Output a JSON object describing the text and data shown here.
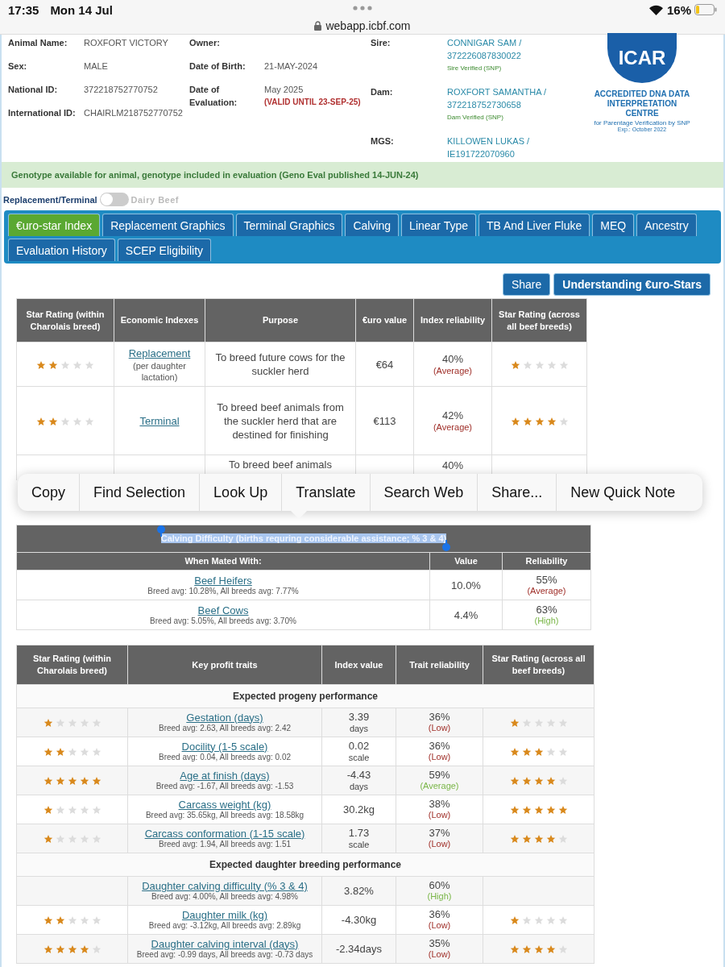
{
  "status_bar": {
    "time": "17:35",
    "date": "Mon 14 Jul",
    "battery": "16%"
  },
  "address_bar": {
    "url": "webapp.icbf.com"
  },
  "animal": {
    "columns": [
      [
        {
          "label": "Animal Name:",
          "value": "ROXFORT VICTORY"
        },
        {
          "label": "Sex:",
          "value": "MALE"
        },
        {
          "label": "National ID:",
          "value": "372218752770752"
        },
        {
          "label": "International ID:",
          "value": "CHAIRLM218752770752"
        }
      ],
      [
        {
          "label": "Owner:"
        },
        {
          "label": "Date of Birth:",
          "value": "21-MAY-2024"
        },
        {
          "label": "Date of Evaluation:",
          "value": "May 2025",
          "warning": "(VALID UNTIL 23-SEP-25)"
        }
      ],
      [
        {
          "label": "Sire:",
          "link": "CONNIGAR SAM / 372226087830022",
          "note": "Sire Verified (SNP)"
        },
        {
          "label": "Dam:",
          "link": "ROXFORT SAMANTHA / 372218752730658",
          "note": "Dam Verified (SNP)"
        },
        {
          "label": "MGS:",
          "link": "KILLOWEN LUKAS / IE191722070960"
        }
      ]
    ]
  },
  "accreditation": {
    "logo": "ICAR",
    "title": "ACCREDITED DNA DATA INTERPRETATION CENTRE",
    "subtitle": "for Parentage Verification by SNP",
    "expiry": "Exp.: October 2022"
  },
  "genotype_notice": "Genotype available for animal, genotype included in evaluation (Geno Eval published 14-JUN-24)",
  "toggle": {
    "left_label": "Replacement/Terminal",
    "right_label": "Dairy Beef",
    "on": false
  },
  "tabs": [
    {
      "label": "€uro-star Index",
      "selected": true
    },
    {
      "label": "Replacement Graphics",
      "selected": false
    },
    {
      "label": "Terminal Graphics",
      "selected": false
    },
    {
      "label": "Calving",
      "selected": false
    },
    {
      "label": "Linear Type",
      "selected": false
    },
    {
      "label": "TB And Liver Fluke",
      "selected": false
    },
    {
      "label": "MEQ",
      "selected": false
    },
    {
      "label": "Ancestry",
      "selected": false
    },
    {
      "label": "Evaluation History",
      "selected": false
    },
    {
      "label": "SCEP Eligibility",
      "selected": false
    }
  ],
  "actions": [
    "Share",
    "Understanding €uro-Stars"
  ],
  "index_table": {
    "columns": [
      "Star Rating (within Charolais breed)",
      "Economic Indexes",
      "Purpose",
      "€uro value",
      "Index reliability",
      "Star Rating (across all beef breeds)"
    ],
    "rows": [
      {
        "rating_within": {
          "stars": 2
        },
        "index": "Replacement",
        "index_note": "(per daughter lactation)",
        "purpose": "To breed future cows for the suckler herd",
        "euro_value": "€64",
        "reliability": "40%",
        "reliability_note": "(Average)",
        "color": "#a0302a",
        "rating_across": {
          "stars": 1
        }
      },
      {
        "rating_within": {
          "stars": 2
        },
        "index": "Terminal",
        "purpose": "To breed beef animals from the suckler herd that are destined for finishing",
        "euro_value": "€113",
        "reliability": "42%",
        "reliability_note": "(Average)",
        "color": "#a0302a",
        "rating_across": {
          "stars": 4
        }
      },
      {
        "purpose": "To breed beef animals",
        "reliability": "40%"
      }
    ]
  },
  "context_menu": {
    "items": [
      "Copy",
      "Find Selection",
      "Look Up",
      "Translate",
      "Search Web",
      "Share...",
      "New Quick Note"
    ]
  },
  "calving_table": {
    "title": "Calving Difficulty (births requring considerable assistance; % 3 & 4)",
    "highlighted": true,
    "columns": [
      "When Mated With:",
      "Value",
      "Reliability"
    ],
    "rows": [
      {
        "name": "Beef Heifers",
        "average": "Breed avg: 10.28%, All breeds avg: 7.77%",
        "value": "10.0%",
        "reliability": "55%",
        "reliability_note": "(Average)",
        "color": "#a0302a"
      },
      {
        "name": "Beef Cows",
        "average": "Breed avg: 5.05%, All breeds avg: 3.70%",
        "value": "4.4%",
        "reliability": "63%",
        "reliability_note": "(High)",
        "color": "#7ab648"
      }
    ]
  },
  "traits_table": {
    "columns": [
      "Star Rating (within Charolais breed)",
      "Key profit traits",
      "Index value",
      "Trait reliability",
      "Star Rating (across all beef breeds)"
    ],
    "sections": [
      {
        "title": "Expected progeny performance",
        "rows": [
          {
            "rating_within": {
              "stars": 1
            },
            "trait": "Gestation (days)",
            "average": "Breed avg: 2.63, All breeds avg: 2.42",
            "value": "3.39",
            "unit": "days",
            "reliability": "36%",
            "reliability_note": "(Low)",
            "color": "#a0302a",
            "rating_across": {
              "stars": 1
            }
          },
          {
            "rating_within": {
              "stars": 2
            },
            "trait": "Docility (1-5 scale)",
            "average": "Breed avg: 0.04, All breeds avg: 0.02",
            "value": "0.02",
            "unit": "scale",
            "reliability": "36%",
            "reliability_note": "(Low)",
            "color": "#a0302a",
            "rating_across": {
              "stars": 3
            }
          },
          {
            "rating_within": {
              "stars": 5
            },
            "trait": "Age at finish (days)",
            "average": "Breed avg: -1.67, All breeds avg: -1.53",
            "value": "-4.43",
            "unit": "days",
            "reliability": "59%",
            "reliability_note": "(Average)",
            "color": "#7ab648",
            "rating_across": {
              "stars": 4
            }
          },
          {
            "rating_within": {
              "stars": 1
            },
            "trait": "Carcass weight (kg)",
            "average": "Breed avg: 35.65kg, All breeds avg: 18.58kg",
            "value": "30.2kg",
            "reliability": "38%",
            "reliability_note": "(Low)",
            "color": "#a0302a",
            "rating_across": {
              "stars": 5
            }
          },
          {
            "rating_within": {
              "stars": 1
            },
            "trait": "Carcass conformation (1-15 scale)",
            "average": "Breed avg: 1.94, All breeds avg: 1.51",
            "value": "1.73",
            "unit": "scale",
            "reliability": "37%",
            "reliability_note": "(Low)",
            "color": "#a0302a",
            "rating_across": {
              "stars": 4
            }
          }
        ]
      },
      {
        "title": "Expected daughter breeding performance",
        "rows": [
          {
            "trait": "Daughter calving difficulty (% 3 & 4)",
            "average": "Breed avg: 4.00%, All breeds avg: 4.98%",
            "value": "3.82%",
            "reliability": "60%",
            "reliability_note": "(High)",
            "color": "#7ab648"
          },
          {
            "rating_within": {
              "stars": 2
            },
            "trait": "Daughter milk (kg)",
            "average": "Breed avg: -3.12kg, All breeds avg: 2.89kg",
            "value": "-4.30kg",
            "reliability": "36%",
            "reliability_note": "(Low)",
            "color": "#a0302a",
            "rating_across": {
              "stars": 1
            }
          },
          {
            "rating_within": {
              "stars": 4
            },
            "trait": "Daughter calving interval (days)",
            "average": "Breed avg: -0.99 days, All breeds avg: -0.73 days",
            "value": "-2.34days",
            "reliability": "35%",
            "reliability_note": "(Low)",
            "color": "#a0302a",
            "rating_across": {
              "stars": 4
            }
          }
        ]
      }
    ]
  }
}
